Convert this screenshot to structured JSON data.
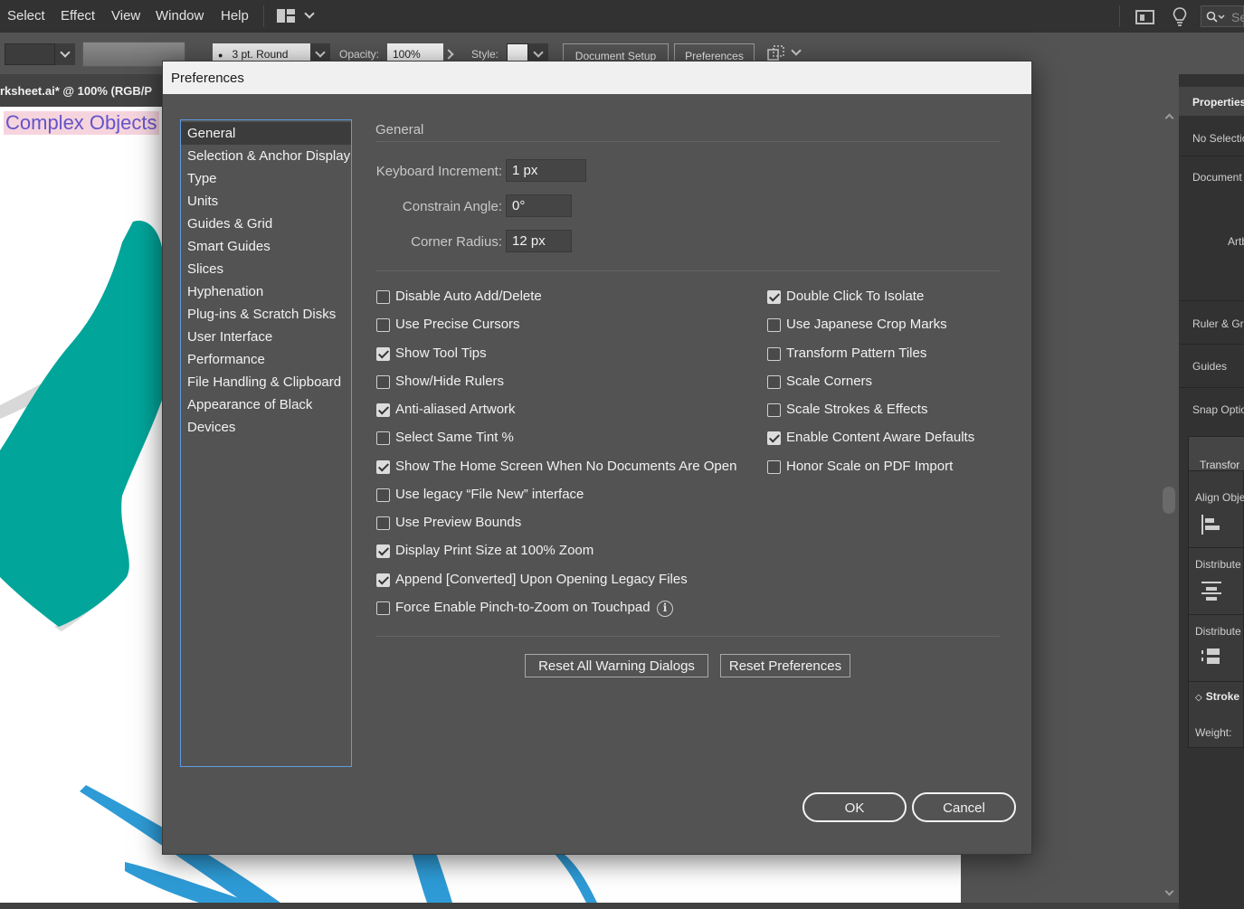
{
  "menubar": {
    "items": [
      "Select",
      "Effect",
      "View",
      "Window",
      "Help"
    ],
    "search_placeholder": "Se"
  },
  "controlbar": {
    "brush": "3 pt. Round",
    "opacity_label": "Opacity:",
    "opacity_value": "100%",
    "style_label": "Style:",
    "document_setup": "Document Setup",
    "preferences": "Preferences"
  },
  "document": {
    "tab_title": "rksheet.ai* @ 100% (RGB/P",
    "artboard_title": "Complex Objects"
  },
  "right_panel": {
    "header": "Properties",
    "no_selection": "No Selectio",
    "document": "Document",
    "artboard": "Artb",
    "ruler_grid": "Ruler & Gr",
    "guides": "Guides",
    "snap_options": "Snap Optio",
    "transform": "Transfor",
    "align_objects": "Align Obje",
    "distribute_objects": "Distribute",
    "distribute_spacing": "Distribute",
    "stroke": "Stroke",
    "weight": "Weight:"
  },
  "dialog": {
    "title": "Preferences",
    "nav": [
      "General",
      "Selection & Anchor Display",
      "Type",
      "Units",
      "Guides & Grid",
      "Smart Guides",
      "Slices",
      "Hyphenation",
      "Plug-ins & Scratch Disks",
      "User Interface",
      "Performance",
      "File Handling & Clipboard",
      "Appearance of Black",
      "Devices"
    ],
    "section_title": "General",
    "fields": {
      "keyboard_increment_label": "Keyboard Increment:",
      "keyboard_increment_value": "1 px",
      "constrain_angle_label": "Constrain Angle:",
      "constrain_angle_value": "0°",
      "corner_radius_label": "Corner Radius:",
      "corner_radius_value": "12 px"
    },
    "left_options": [
      {
        "label": "Disable Auto Add/Delete",
        "checked": false
      },
      {
        "label": "Use Precise Cursors",
        "checked": false
      },
      {
        "label": "Show Tool Tips",
        "checked": true
      },
      {
        "label": "Show/Hide Rulers",
        "checked": false
      },
      {
        "label": "Anti-aliased Artwork",
        "checked": true
      },
      {
        "label": "Select Same Tint %",
        "checked": false
      },
      {
        "label": "Show The Home Screen When No Documents Are Open",
        "checked": true
      },
      {
        "label": "Use legacy “File New” interface",
        "checked": false
      },
      {
        "label": "Use Preview Bounds",
        "checked": false
      },
      {
        "label": "Display Print Size at 100% Zoom",
        "checked": true
      },
      {
        "label": "Append [Converted] Upon Opening Legacy Files",
        "checked": true
      },
      {
        "label": "Force Enable Pinch-to-Zoom on Touchpad",
        "checked": false
      }
    ],
    "right_options": [
      {
        "label": "Double Click To Isolate",
        "checked": true
      },
      {
        "label": "Use Japanese Crop Marks",
        "checked": false
      },
      {
        "label": "Transform Pattern Tiles",
        "checked": false
      },
      {
        "label": "Scale Corners",
        "checked": false
      },
      {
        "label": "Scale Strokes & Effects",
        "checked": false
      },
      {
        "label": "Enable Content Aware Defaults",
        "checked": true
      },
      {
        "label": "Honor Scale on PDF Import",
        "checked": false
      }
    ],
    "reset_warnings": "Reset All Warning Dialogs",
    "reset_preferences": "Reset Preferences",
    "ok": "OK",
    "cancel": "Cancel"
  },
  "colors": {
    "accent_teal": "#01A59A",
    "accent_blue": "#2E9BD6",
    "selection_border": "#5E9BE4"
  }
}
